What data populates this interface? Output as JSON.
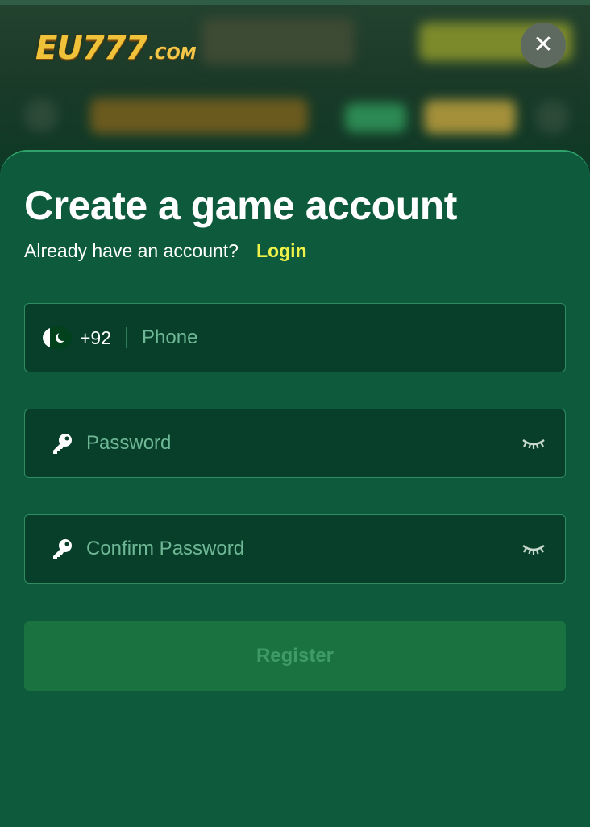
{
  "header": {
    "logo_main": "EU777",
    "logo_suffix": ".COM",
    "close_label": "✕"
  },
  "form": {
    "title": "Create a game account",
    "subtitle": "Already have an account?",
    "login_label": "Login",
    "phone": {
      "country_code": "+92",
      "placeholder": "Phone",
      "flag": "pakistan-flag-icon"
    },
    "password": {
      "placeholder": "Password",
      "icon": "key-icon",
      "toggle_icon": "eye-closed-icon"
    },
    "confirm_password": {
      "placeholder": "Confirm Password",
      "icon": "key-icon",
      "toggle_icon": "eye-closed-icon"
    },
    "register_label": "Register"
  },
  "colors": {
    "sheet": "#0e5a3d",
    "field_bg": "#083f2a",
    "login_accent": "#eef249",
    "register_bg": "#19723f"
  }
}
